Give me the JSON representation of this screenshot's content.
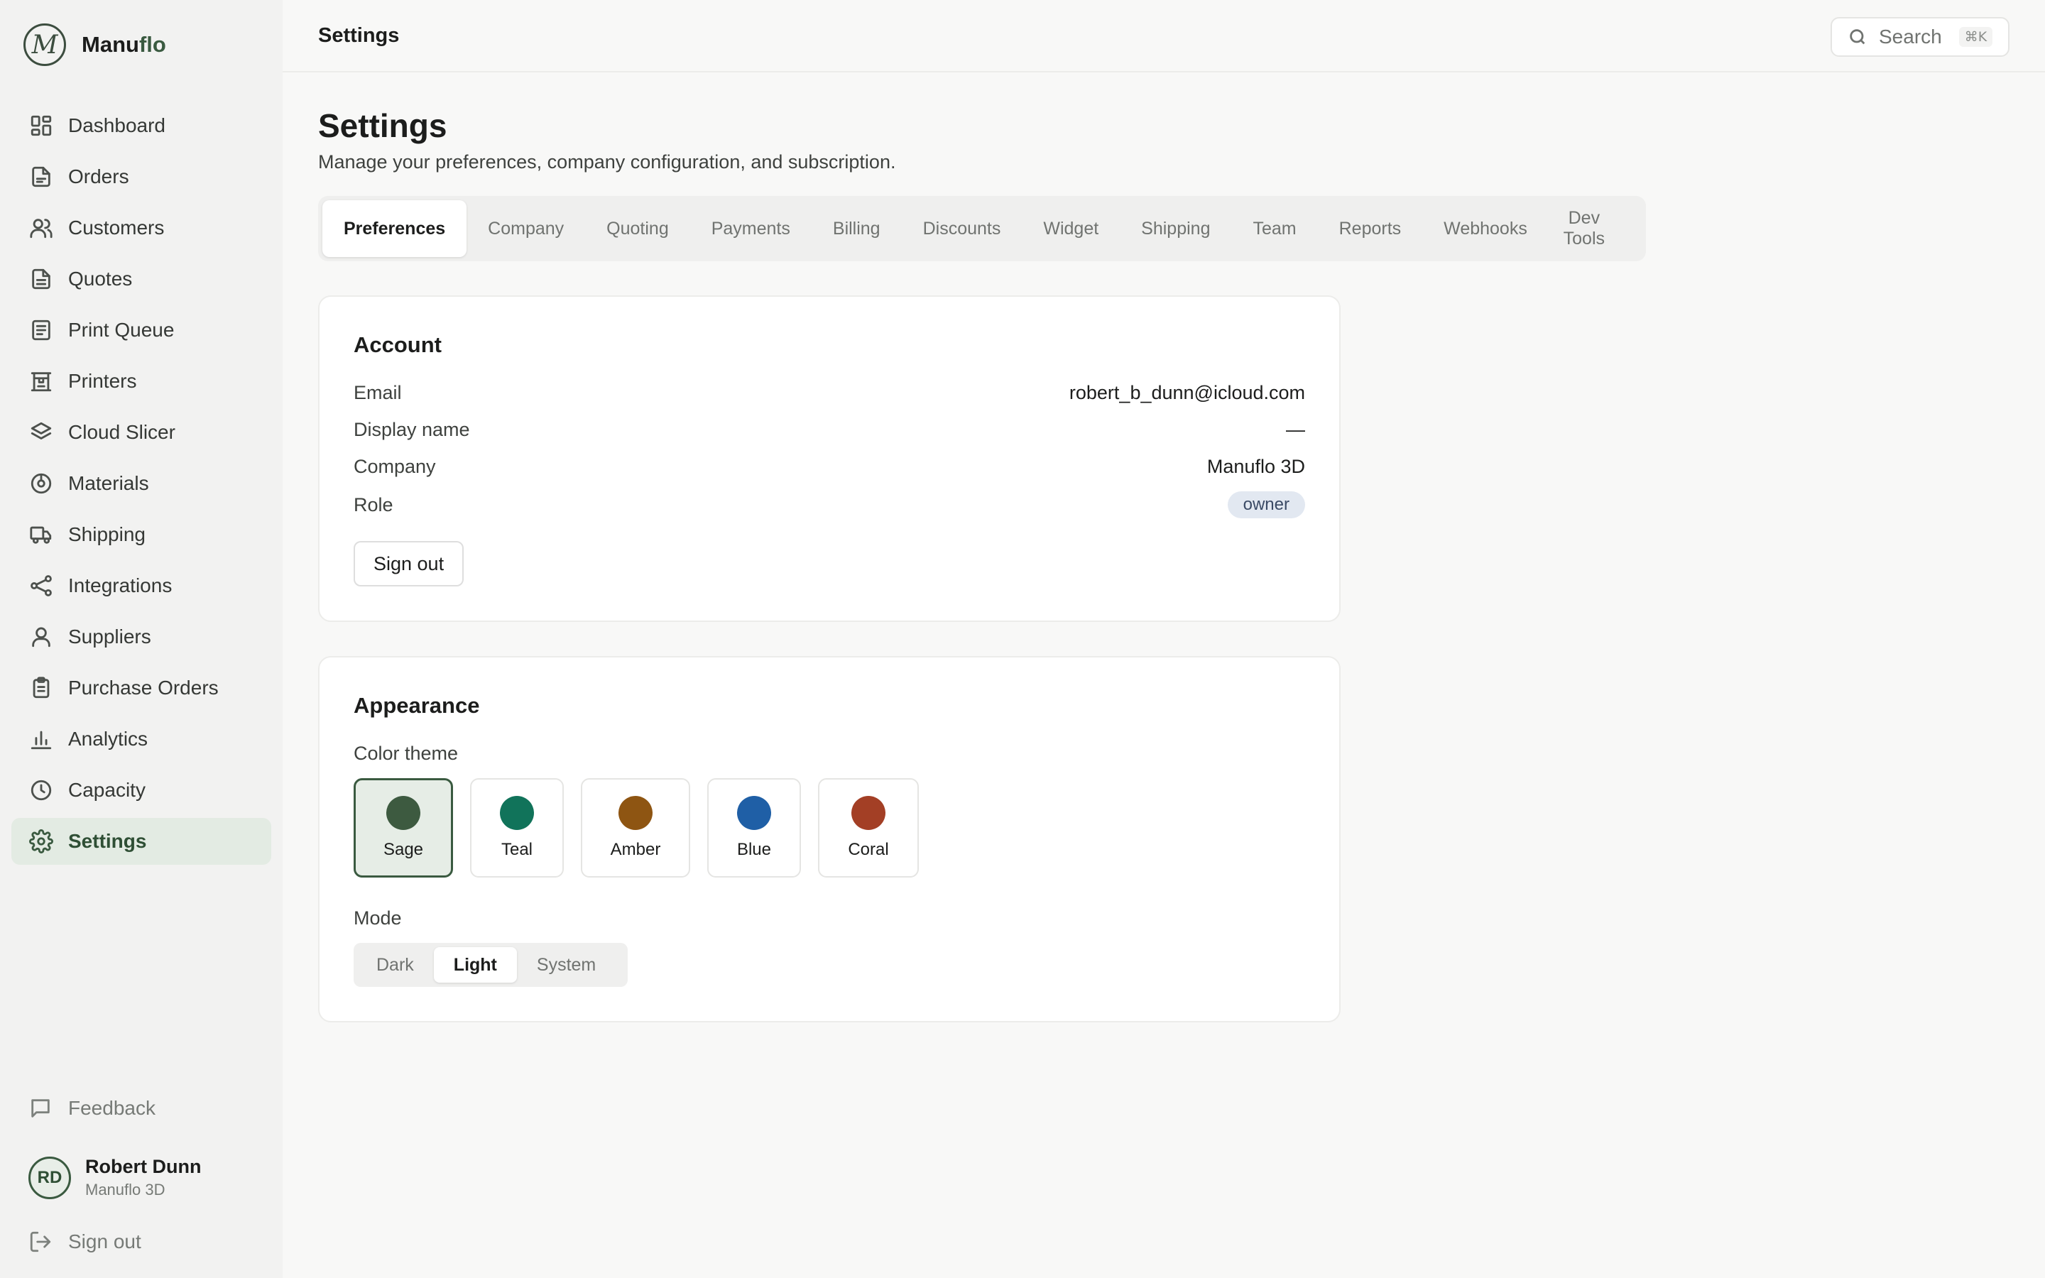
{
  "brand": {
    "logo_letter": "M",
    "name_part1": "Manu",
    "name_part2": "flo"
  },
  "sidebar": {
    "items": [
      {
        "label": "Dashboard",
        "icon": "grid-icon"
      },
      {
        "label": "Orders",
        "icon": "file-icon"
      },
      {
        "label": "Customers",
        "icon": "users-icon"
      },
      {
        "label": "Quotes",
        "icon": "document-icon"
      },
      {
        "label": "Print Queue",
        "icon": "list-icon"
      },
      {
        "label": "Printers",
        "icon": "printer-icon"
      },
      {
        "label": "Cloud Slicer",
        "icon": "layers-icon"
      },
      {
        "label": "Materials",
        "icon": "spool-icon"
      },
      {
        "label": "Shipping",
        "icon": "truck-icon"
      },
      {
        "label": "Integrations",
        "icon": "share-icon"
      },
      {
        "label": "Suppliers",
        "icon": "person-icon"
      },
      {
        "label": "Purchase Orders",
        "icon": "clipboard-icon"
      },
      {
        "label": "Analytics",
        "icon": "bar-chart-icon"
      },
      {
        "label": "Capacity",
        "icon": "clock-icon"
      },
      {
        "label": "Settings",
        "icon": "gear-icon",
        "active": true
      }
    ],
    "feedback_label": "Feedback",
    "user": {
      "initials": "RD",
      "name": "Robert Dunn",
      "org": "Manuflo 3D"
    },
    "signout_label": "Sign out"
  },
  "topbar": {
    "title": "Settings",
    "search_placeholder": "Search",
    "search_shortcut": "⌘K"
  },
  "page": {
    "title": "Settings",
    "subtitle": "Manage your preferences, company configuration, and subscription."
  },
  "tabs": [
    "Preferences",
    "Company",
    "Quoting",
    "Payments",
    "Billing",
    "Discounts",
    "Widget",
    "Shipping",
    "Team",
    "Reports",
    "Webhooks",
    "Dev Tools"
  ],
  "active_tab": "Preferences",
  "account": {
    "title": "Account",
    "rows": {
      "email": {
        "label": "Email",
        "value": "robert_b_dunn@icloud.com"
      },
      "display_name": {
        "label": "Display name",
        "value": "—"
      },
      "company": {
        "label": "Company",
        "value": "Manuflo 3D"
      },
      "role": {
        "label": "Role",
        "value": "owner"
      }
    },
    "signout_label": "Sign out"
  },
  "appearance": {
    "title": "Appearance",
    "color_theme_label": "Color theme",
    "themes": [
      {
        "label": "Sage",
        "color": "#3d5a40",
        "selected": true
      },
      {
        "label": "Teal",
        "color": "#11735a"
      },
      {
        "label": "Amber",
        "color": "#8e5512"
      },
      {
        "label": "Blue",
        "color": "#1f5fa6"
      },
      {
        "label": "Coral",
        "color": "#a33f25"
      }
    ],
    "mode_label": "Mode",
    "modes": [
      "Dark",
      "Light",
      "System"
    ],
    "selected_mode": "Light"
  },
  "colors": {
    "accent": "#3a5a40",
    "active_bg": "#e3ebe3",
    "badge_bg": "#e2e8f1"
  }
}
